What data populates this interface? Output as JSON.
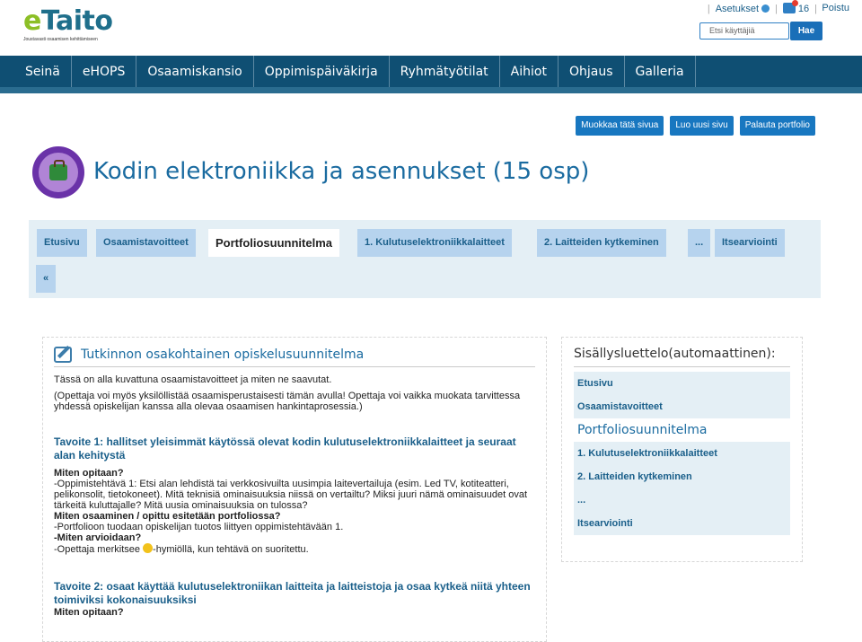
{
  "header": {
    "logo_e": "e",
    "logo_rest": "Taito",
    "logo_tagline": "Joustavasti osaamisen kehittämiseen",
    "settings_label": "Asetukset",
    "messages_count": "16",
    "logout_label": "Poistu",
    "search_placeholder": "Etsi käyttäjiä",
    "search_button": "Hae"
  },
  "nav": [
    "Seinä",
    "eHOPS",
    "Osaamiskansio",
    "Oppimispäiväkirja",
    "Ryhmätyötilat",
    "Aihiot",
    "Ohjaus",
    "Galleria"
  ],
  "actions": {
    "edit_page": "Muokkaa tätä sivua",
    "new_page": "Luo uusi sivu",
    "submit_portfolio": "Palauta portfolio"
  },
  "page_title": "Kodin elektroniikka ja asennukset (15 osp)",
  "tabs": [
    "Etusivu",
    "Osaamistavoitteet",
    "Portfoliosuunnitelma",
    "1. Kulutuselektroniikkalaitteet",
    "2. Laitteiden kytkeminen",
    "...",
    "Itsearviointi",
    "«"
  ],
  "content": {
    "section_title": "Tutkinnon osakohtainen opiskelusuunnitelma",
    "intro": "Tässä on alla kuvattuna osaamistavoitteet ja miten ne saavutat.",
    "note": "(Opettaja voi myös yksilöllistää osaamisperustaisesti tämän avulla! Opettaja voi vaikka muokata tarvittessa yhdessä opiskelijan kanssa alla olevaa osaamisen hankintaprosessia.)",
    "goal1": "Tavoite 1: hallitset yleisimmät käytössä olevat kodin kulutuselektroniikkalaitteet ja seuraat alan kehitystä",
    "q1": "Miten opitaan?",
    "a1": "-Oppimistehtävä 1: Etsi alan lehdistä tai verkkosivuilta uusimpia laitevertailuja (esim. Led TV, kotiteatteri, pelikonsolit, tietokoneet). Mitä teknisiä ominaisuuksia niissä on vertailtu? Miksi juuri nämä ominaisuudet ovat tärkeitä kuluttajalle? Mitä uusia ominaisuuksia on tulossa?",
    "q2": "Miten osaaminen / opittu esitetään portfoliossa?",
    "a2": "-Portfolioon tuodaan opiskelijan tuotos liittyen oppimistehtävään 1.",
    "q3": "-Miten arvioidaan?",
    "a3a": "-Opettaja merkitsee",
    "a3b": "-hymiöllä, kun tehtävä on suoritettu.",
    "goal2": "Tavoite 2: osaat käyttää kulutuselektroniikan laitteita ja laitteistoja  ja osaa kytkeä niitä yhteen toimiviksi kokonaisuuksiksi",
    "q4": "Miten opitaan?"
  },
  "toc": {
    "title": "Sisällysluettelo(automaattinen):",
    "items": [
      "Etusivu",
      "Osaamistavoitteet",
      "Portfoliosuunnitelma",
      "1. Kulutuselektroniikkalaitteet",
      "2. Laitteiden kytkeminen",
      "...",
      "Itsearviointi"
    ]
  },
  "colors": {
    "nav_bg": "#0f4f73",
    "accent_blue": "#1877c0",
    "tab_bg": "#b6d3ee",
    "logo_green": "#8cbf26"
  }
}
